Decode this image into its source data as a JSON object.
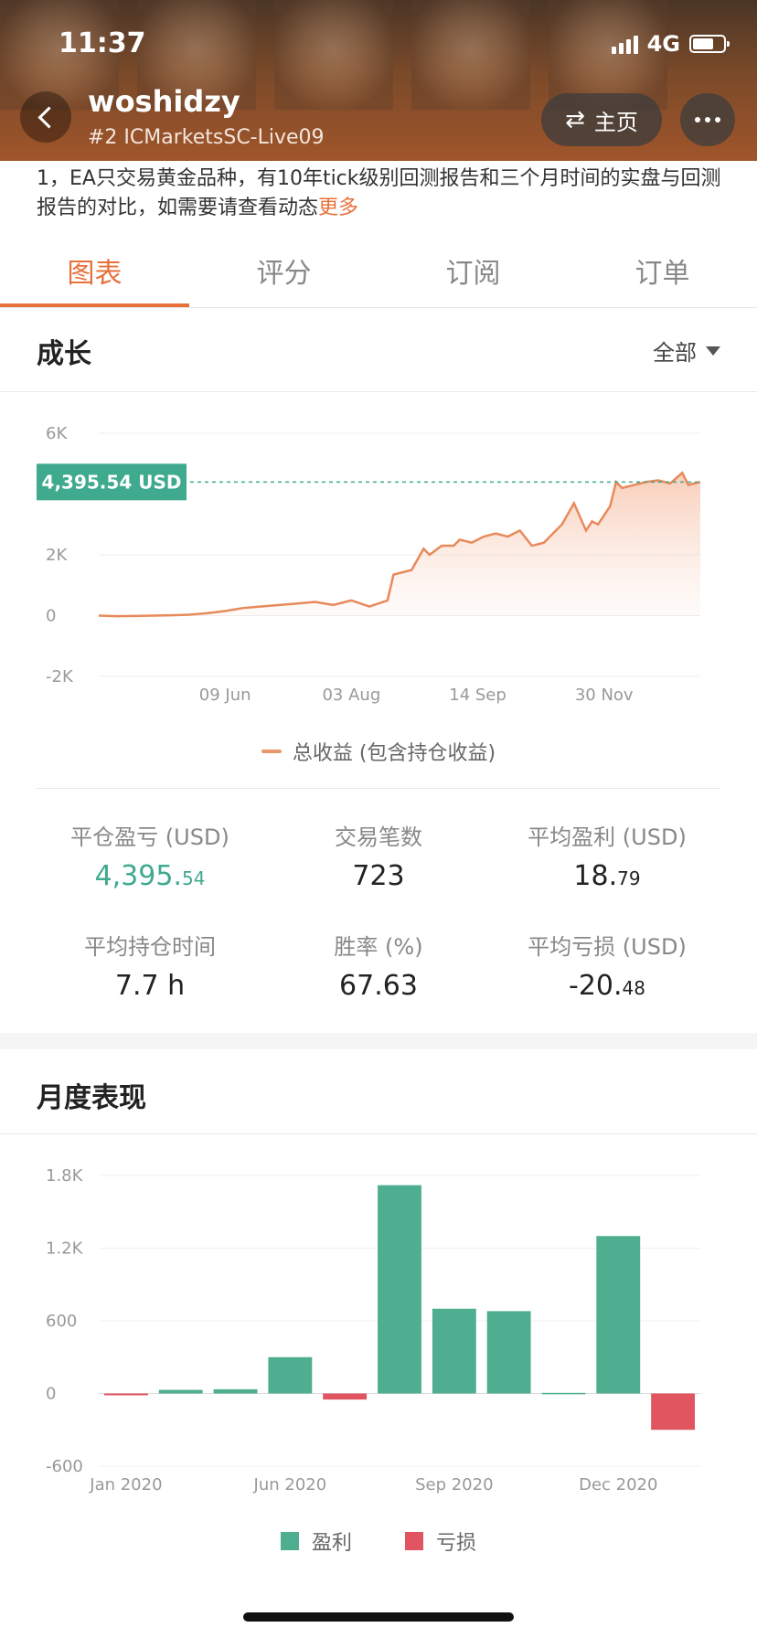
{
  "status_bar": {
    "time": "11:37",
    "network": "4G"
  },
  "header": {
    "username": "woshidzy",
    "subtitle": "#2 ICMarketsSC-Live09",
    "home_label": "主页",
    "back_icon": "chevron-left-icon",
    "swap_icon": "swap-arrows-icon",
    "more_icon": "more-dots-icon"
  },
  "description": {
    "text": "1，EA只交易黄金品种，有10年tick级别回测报告和三个月时间的实盘与回测报告的对比，如需要请查看动态",
    "more_link": "更多"
  },
  "tabs": [
    {
      "label": "图表",
      "active": true
    },
    {
      "label": "评分",
      "active": false
    },
    {
      "label": "订阅",
      "active": false
    },
    {
      "label": "订单",
      "active": false
    }
  ],
  "growth": {
    "title": "成长",
    "range": "全部",
    "current_badge": "4,395.54 USD",
    "legend": "总收益 (包含持仓收益)"
  },
  "stats": [
    {
      "label": "平仓盈亏 (USD)",
      "int": "4,395.",
      "dec": "54",
      "teal": true
    },
    {
      "label": "交易笔数",
      "int": "723",
      "dec": "",
      "teal": false
    },
    {
      "label": "平均盈利 (USD)",
      "int": "18.",
      "dec": "79",
      "teal": false
    },
    {
      "label": "平均持仓时间",
      "int": "7.7 h",
      "dec": "",
      "teal": false
    },
    {
      "label": "胜率 (%)",
      "int": "67.63",
      "dec": "",
      "teal": false
    },
    {
      "label": "平均亏损 (USD)",
      "int": "-20.",
      "dec": "48",
      "teal": false
    }
  ],
  "monthly": {
    "title": "月度表现",
    "legend_profit": "盈利",
    "legend_loss": "亏损"
  },
  "colors": {
    "accent": "#e8703a",
    "teal": "#4fae8f",
    "loss": "#e0555f",
    "line": "#e8895a"
  },
  "chart_data": [
    {
      "type": "area",
      "y_ticks": [
        "6K",
        "2K",
        "0",
        "-2K"
      ],
      "x_ticks": [
        "09 Jun",
        "03 Aug",
        "14 Sep",
        "30 Nov"
      ],
      "ylim": [
        -2000,
        6000
      ],
      "current_value": 4395.54,
      "series": [
        {
          "name": "总收益 (包含持仓收益)",
          "x": [
            0,
            0.03,
            0.06,
            0.09,
            0.12,
            0.15,
            0.18,
            0.21,
            0.24,
            0.27,
            0.3,
            0.33,
            0.36,
            0.39,
            0.42,
            0.45,
            0.48,
            0.49,
            0.5,
            0.52,
            0.54,
            0.55,
            0.57,
            0.59,
            0.6,
            0.62,
            0.64,
            0.66,
            0.68,
            0.7,
            0.72,
            0.74,
            0.75,
            0.76,
            0.77,
            0.79,
            0.81,
            0.82,
            0.83,
            0.84,
            0.85,
            0.86,
            0.87,
            0.89,
            0.91,
            0.93,
            0.95,
            0.97,
            0.98,
            1.0
          ],
          "values": [
            0,
            -20,
            -10,
            0,
            10,
            30,
            80,
            150,
            250,
            300,
            350,
            400,
            450,
            350,
            500,
            300,
            500,
            1350,
            1400,
            1500,
            2200,
            2000,
            2300,
            2300,
            2500,
            2400,
            2600,
            2700,
            2600,
            2800,
            2300,
            2400,
            2600,
            2800,
            3000,
            3700,
            2800,
            3100,
            3000,
            3300,
            3600,
            4400,
            4200,
            4300,
            4400,
            4450,
            4350,
            4700,
            4300,
            4396
          ]
        }
      ]
    },
    {
      "type": "bar",
      "y_ticks": [
        "1.8K",
        "1.2K",
        "600",
        "0",
        "-600"
      ],
      "x_ticks": [
        "Jan 2020",
        "Jun 2020",
        "Sep 2020",
        "Dec 2020"
      ],
      "ylim": [
        -600,
        1800
      ],
      "series": [
        {
          "name": "盈利/亏损",
          "values": [
            -15,
            30,
            35,
            300,
            -50,
            1720,
            700,
            680,
            5,
            1300,
            -300
          ]
        }
      ]
    }
  ]
}
